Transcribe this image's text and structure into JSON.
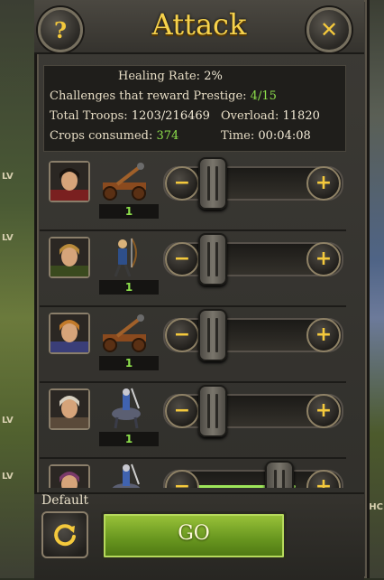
{
  "dialog": {
    "title": "Attack"
  },
  "header": {
    "help_label": "?",
    "close_label": "✕"
  },
  "stats": {
    "healing_label": "Healing Rate:",
    "healing_value": "2%",
    "prestige_label": "Challenges that reward Prestige:",
    "prestige_value": "4/15",
    "troops_label": "Total Troops:",
    "troops_value": "1203/216469",
    "overload_label": "Overload:",
    "overload_value": "11820",
    "crops_label": "Crops consumed:",
    "crops_value": "374",
    "time_label": "Time:",
    "time_value": "00:04:08"
  },
  "troops": [
    {
      "count": "1",
      "unit_icon": "catapult-icon",
      "hero_icon": "hero-portrait-icon",
      "slider_fraction": 0.0
    },
    {
      "count": "1",
      "unit_icon": "archer-icon",
      "hero_icon": "hero-portrait-icon",
      "slider_fraction": 0.0
    },
    {
      "count": "1",
      "unit_icon": "catapult-icon",
      "hero_icon": "hero-portrait-icon",
      "slider_fraction": 0.0
    },
    {
      "count": "1",
      "unit_icon": "cavalry-icon",
      "hero_icon": "hero-portrait-icon",
      "slider_fraction": 0.0
    },
    {
      "count": "",
      "unit_icon": "cavalry-icon",
      "hero_icon": "hero-portrait-icon",
      "slider_fraction": 0.85
    }
  ],
  "footer": {
    "default_label": "Default",
    "go_label": "GO"
  },
  "background": {
    "left_labels": [
      "LV",
      "LV",
      "LV",
      "LV"
    ],
    "right_labels": [
      "SHC"
    ]
  },
  "colors": {
    "accent_green": "#8ee04c",
    "title_gold": "#f6d24c",
    "go_green": "#6a9820"
  }
}
